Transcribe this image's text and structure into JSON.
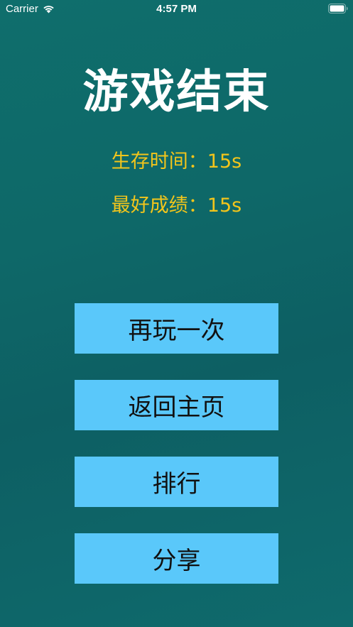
{
  "status_bar": {
    "carrier": "Carrier",
    "time": "4:57 PM",
    "icons": [
      "wifi-icon",
      "battery-icon"
    ]
  },
  "game_over": {
    "title": "游戏结束",
    "survival_time": "生存时间：15s",
    "best_score": "最好成绩：15s"
  },
  "buttons": {
    "play_again": "再玩一次",
    "back_home": "返回主页",
    "ranking": "排行",
    "share": "分享"
  },
  "colors": {
    "background": "#0e6868",
    "title": "#ffffff",
    "stats": "#f2c51b",
    "button_bg": "#5ac8fa",
    "button_text": "#111111"
  }
}
